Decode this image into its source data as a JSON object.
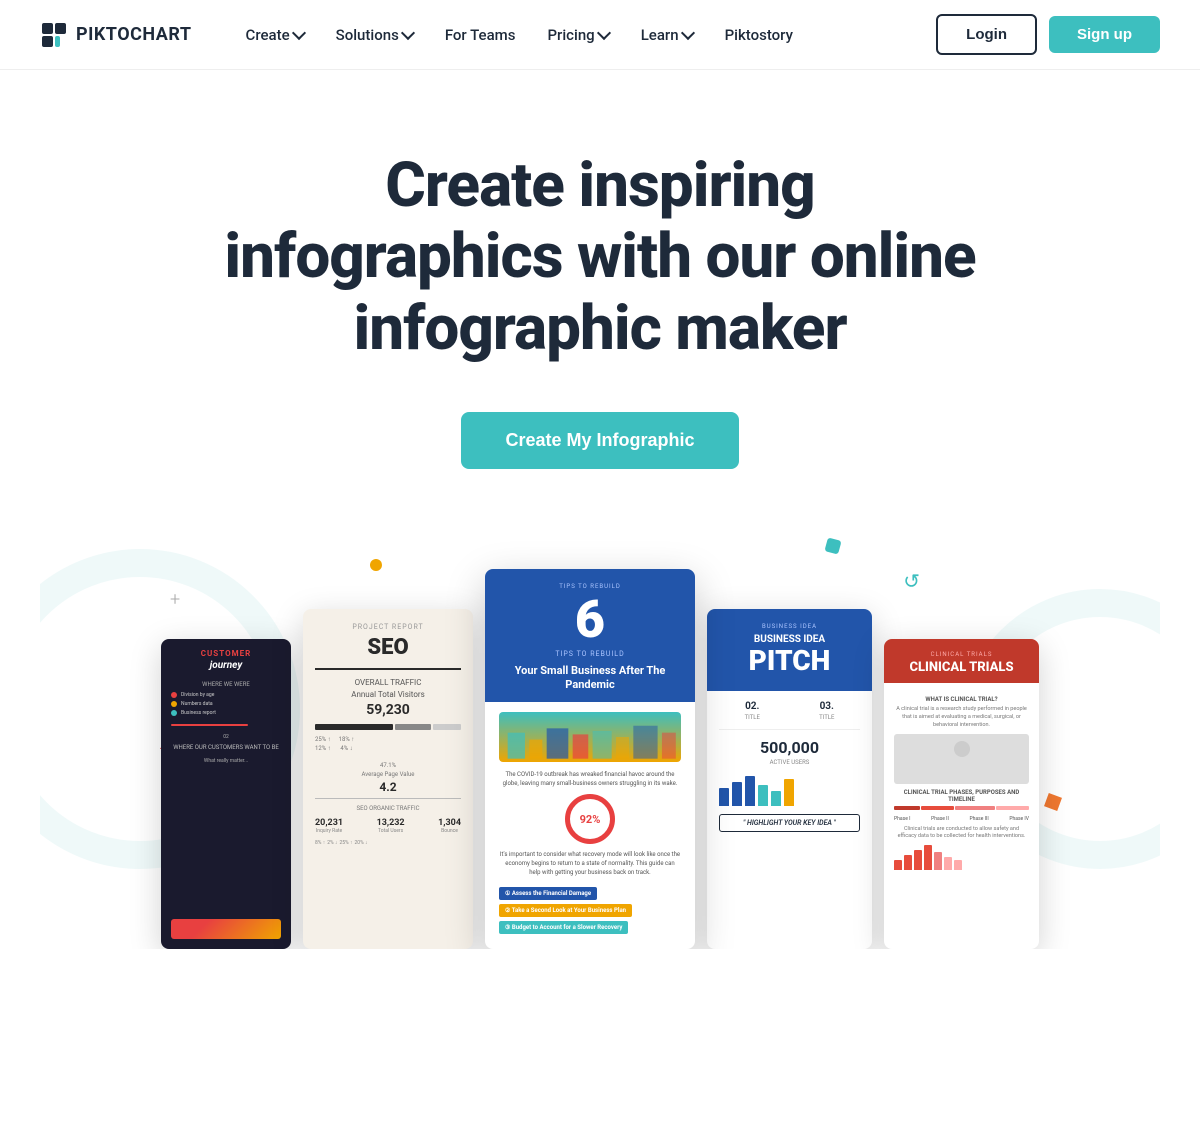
{
  "brand": {
    "logo_text": "PIKTOCHART",
    "logo_icon": "P"
  },
  "nav": {
    "items": [
      {
        "label": "Create",
        "has_dropdown": true
      },
      {
        "label": "Solutions",
        "has_dropdown": true
      },
      {
        "label": "For Teams",
        "has_dropdown": false
      },
      {
        "label": "Pricing",
        "has_dropdown": true
      },
      {
        "label": "Learn",
        "has_dropdown": true
      },
      {
        "label": "Piktostory",
        "has_dropdown": false
      }
    ],
    "login_label": "Login",
    "signup_label": "Sign up"
  },
  "hero": {
    "title": "Create inspiring infographics with our online infographic maker",
    "cta_label": "Create My Infographic"
  },
  "showcase": {
    "cards": [
      {
        "id": "customer-journey",
        "type": "dark"
      },
      {
        "id": "seo",
        "type": "beige"
      },
      {
        "id": "tips",
        "type": "blue-featured"
      },
      {
        "id": "pitch",
        "type": "blue"
      },
      {
        "id": "clinical",
        "type": "red"
      }
    ]
  },
  "cards": {
    "card1": {
      "title": "CUSTOMER journey",
      "where_we_were": "WHERE WE WERE",
      "subtitle": "WHERE OUR CUSTOMERS WANT TO BE"
    },
    "card2": {
      "tag": "PROJECT REPORT",
      "title": "SEO",
      "overall_traffic": "OVERALL TRAFFIC",
      "stat1": "Annual Total Visitors",
      "num1": "59,230",
      "stat2": "47.1%",
      "stat3": "Average Page Value",
      "num2": "4.2",
      "seo_organic": "SEO ORGANIC TRAFFIC",
      "num3": "20,231",
      "num4": "13,232",
      "num5": "1,304"
    },
    "card3": {
      "label": "TIPS TO REBUILD",
      "num": "6",
      "tips_label": "TIPS TO REBUILD",
      "headline": "Your Small Business After The Pandemic",
      "paragraph1": "The COVID-19 outbreak has wreaked financial havoc around the globe, leaving many small-business owners struggling in its wake.",
      "pct": "92%",
      "paragraph2": "It's important to consider what recovery mode will look like once the economy begins to return to a state of normality. This guide can help with getting your business back on track."
    },
    "card4": {
      "label": "BUSINESS IDEA",
      "title": "BUSINESS IDEA",
      "bigtitle": "PITCH",
      "num1": "02.",
      "label1": "TITLE",
      "num2": "03.",
      "label2": "TITLE",
      "bignum": "500,000",
      "numlabel": "ACTIVE USERS",
      "quote": "\" HIGHLIGHT YOUR KEY IDEA \""
    },
    "card5": {
      "label": "CLINICAL TRIALS",
      "title": "CLINICAL TRIALS",
      "section1": "WHAT IS CLINICAL TRIAL?",
      "section2": "CLINICAL TRIAL PHASES, PURPOSES AND TIMELINE"
    }
  }
}
